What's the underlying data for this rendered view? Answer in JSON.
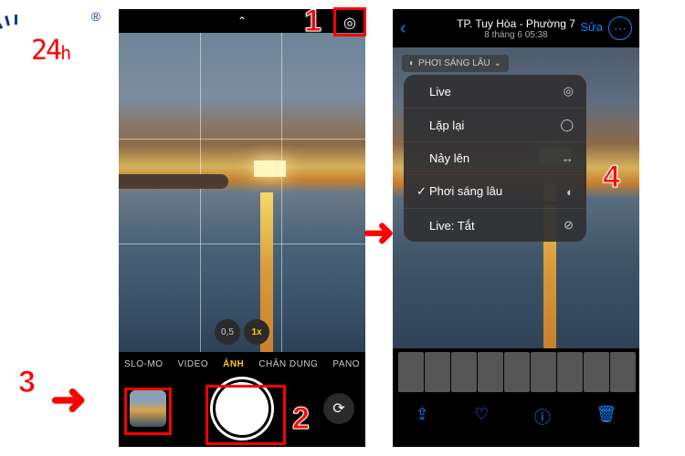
{
  "logo": {
    "text": "24",
    "suffix": "h",
    "reg": "®"
  },
  "camera": {
    "zoom": [
      "0,5",
      "1x"
    ],
    "zoomActive": 1,
    "modes": [
      "SLO-MO",
      "VIDEO",
      "ẢNH",
      "CHÂN DUNG",
      "PANO"
    ],
    "modeActive": 2
  },
  "photos": {
    "title": "TP. Tuy Hòa - Phường 7",
    "date": "8 tháng 6 05:38",
    "edit": "Sửa",
    "badge": "PHƠI SÁNG LÂU",
    "menu": [
      {
        "label": "Live",
        "icon": "◎",
        "checked": false
      },
      {
        "label": "Lặp lại",
        "icon": "◯",
        "checked": false
      },
      {
        "label": "Nảy lên",
        "icon": "↔",
        "checked": false
      },
      {
        "label": "Phơi sáng lâu",
        "icon": "◐",
        "checked": true
      },
      {
        "label": "Live: Tắt",
        "icon": "⊘",
        "checked": false
      }
    ]
  },
  "steps": {
    "1": "1",
    "2": "2",
    "3": "3",
    "4": "4"
  }
}
